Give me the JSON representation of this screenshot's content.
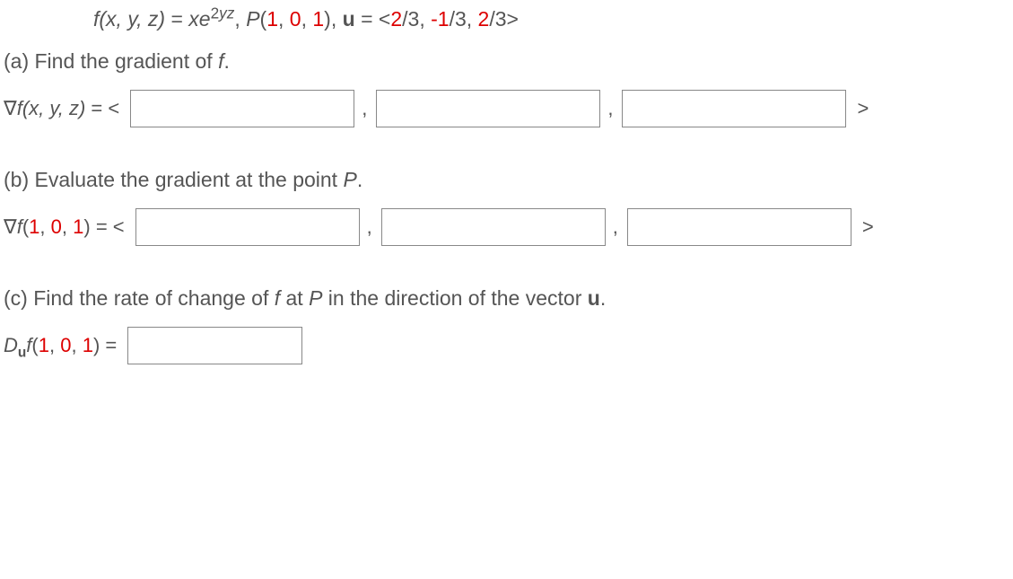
{
  "problem": {
    "func_lhs_f": "f",
    "func_lhs_args": "(x, y, z)",
    "func_eq": " = ",
    "func_rhs_x": "x",
    "func_rhs_e": "e",
    "func_rhs_exp1": "2",
    "func_rhs_exp2": "yz",
    "sep1": ", ",
    "P_label": "P",
    "P_args_open": "(",
    "P_args_1": "1",
    "P_args_c1": ", ",
    "P_args_2": "0",
    "P_args_c2": ", ",
    "P_args_3": "1",
    "P_args_close": ")",
    "sep2": ", ",
    "u_label": "u",
    "u_eq": " = ",
    "u_open": "<",
    "u_1": "2",
    "u_1d": "/3",
    "u_c1": ", ",
    "u_2": "-1",
    "u_2d": "/3",
    "u_c2": ", ",
    "u_3": "2",
    "u_3d": "/3",
    "u_close": ">"
  },
  "part_a": {
    "label": "(a) Find the gradient of ",
    "fvar": "f",
    "period": ".",
    "ans_nabla": "∇",
    "ans_f": "f",
    "ans_args": "(x, y, z)",
    "ans_eq": " = <",
    "comma": " , ",
    "close": ">"
  },
  "part_b": {
    "label": "(b) Evaluate the gradient at the point ",
    "Pvar": "P",
    "period": ".",
    "ans_nabla": "∇",
    "ans_f": "f",
    "ans_open": "(",
    "ans_1": "1",
    "ans_c1": ", ",
    "ans_2": "0",
    "ans_c2": ", ",
    "ans_3": "1",
    "ans_close": ")",
    "ans_eq": " = <",
    "comma": " , ",
    "close": ">"
  },
  "part_c": {
    "label_1": "(c) Find the rate of change of ",
    "fvar": "f",
    "label_2": " at ",
    "Pvar": "P",
    "label_3": " in the direction of the vector ",
    "uvar": "u",
    "period": ".",
    "ans_D": "D",
    "ans_u": "u",
    "ans_f": "f",
    "ans_open": "(",
    "ans_1": "1",
    "ans_c1": ", ",
    "ans_2": "0",
    "ans_c2": ", ",
    "ans_3": "1",
    "ans_close": ")",
    "ans_eq": " = "
  }
}
